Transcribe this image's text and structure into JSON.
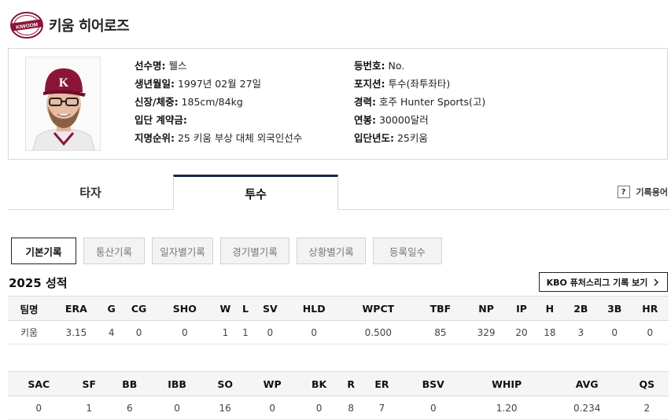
{
  "team": {
    "name": "키움 히어로즈",
    "logo_text": "KIWOOM",
    "logo_colors": {
      "primary": "#8a1538",
      "accent": "#ffffff"
    }
  },
  "player": {
    "fields_left": [
      {
        "label": "선수명:",
        "value": "웰스"
      },
      {
        "label": "생년월일:",
        "value": "1997년 02월 27일"
      },
      {
        "label": "신장/체중:",
        "value": "185cm/84kg"
      },
      {
        "label": "입단 계약금:",
        "value": ""
      },
      {
        "label": "지명순위:",
        "value": "25 키움 부상 대체 외국인선수"
      }
    ],
    "fields_right": [
      {
        "label": "등번호:",
        "value": "No."
      },
      {
        "label": "포지션:",
        "value": "투수(좌투좌타)"
      },
      {
        "label": "경력:",
        "value": "호주 Hunter Sports(고)"
      },
      {
        "label": "연봉:",
        "value": "30000달러"
      },
      {
        "label": "입단년도:",
        "value": "25키움"
      }
    ]
  },
  "tabs": {
    "hitter": "타자",
    "pitcher": "투수",
    "active": "pitcher"
  },
  "glossary": {
    "icon": "?",
    "label": "기록용어"
  },
  "subtabs": [
    {
      "label": "기본기록",
      "active": true
    },
    {
      "label": "통산기록",
      "active": false
    },
    {
      "label": "일자별기록",
      "active": false
    },
    {
      "label": "경기별기록",
      "active": false
    },
    {
      "label": "상황별기록",
      "active": false
    },
    {
      "label": "등록일수",
      "active": false
    }
  ],
  "season": {
    "title": "2025 성적",
    "futures_button": "KBO 퓨처스리그 기록 보기",
    "futures_icon": "chevron-right"
  },
  "table1": {
    "headers": [
      "팀명",
      "ERA",
      "G",
      "CG",
      "SHO",
      "W",
      "L",
      "SV",
      "HLD",
      "WPCT",
      "TBF",
      "NP",
      "IP",
      "H",
      "2B",
      "3B",
      "HR"
    ],
    "row": [
      "키움",
      "3.15",
      "4",
      "0",
      "0",
      "1",
      "1",
      "0",
      "0",
      "0.500",
      "85",
      "329",
      "20",
      "18",
      "3",
      "0",
      "0"
    ]
  },
  "table2": {
    "headers": [
      "SAC",
      "SF",
      "BB",
      "IBB",
      "SO",
      "WP",
      "BK",
      "R",
      "ER",
      "BSV",
      "WHIP",
      "AVG",
      "QS"
    ],
    "row": [
      "0",
      "1",
      "6",
      "0",
      "16",
      "0",
      "0",
      "8",
      "7",
      "0",
      "1.20",
      "0.234",
      "2"
    ]
  },
  "colors": {
    "navy": "#14284d",
    "border": "#d7d7d7",
    "header_bg": "#f5f5f5"
  }
}
